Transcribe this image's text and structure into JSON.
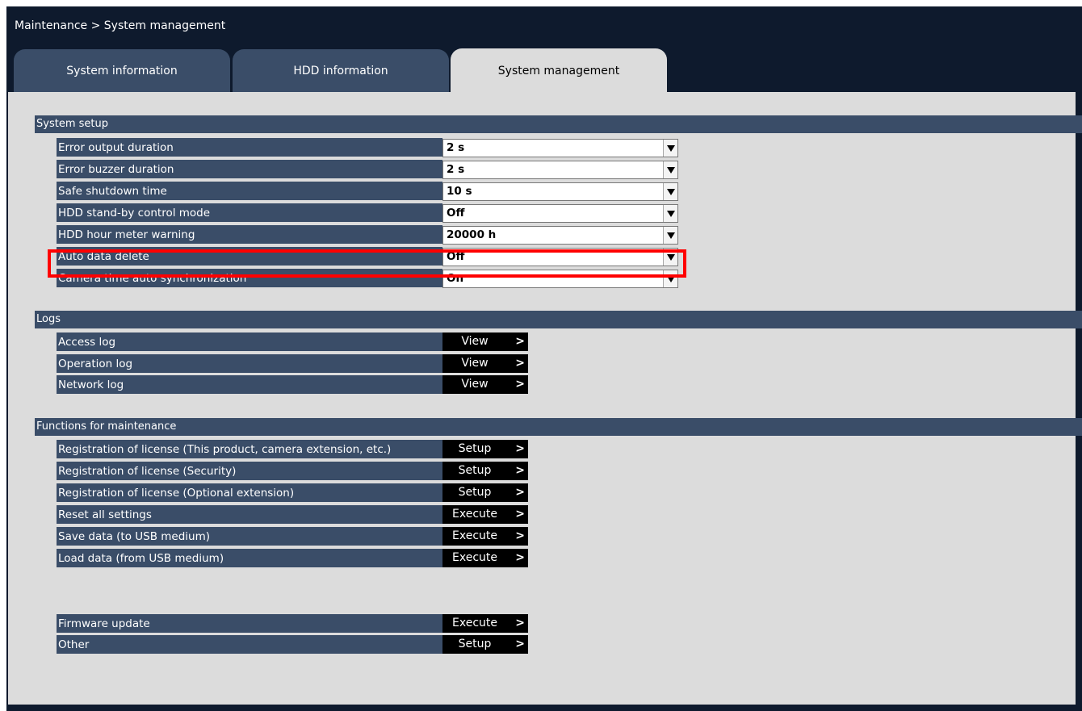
{
  "breadcrumb": "Maintenance > System management",
  "tabs": [
    {
      "label": "System information"
    },
    {
      "label": "HDD information"
    },
    {
      "label": "System management"
    }
  ],
  "sections": {
    "system_setup": "System setup",
    "logs": "Logs",
    "maintenance": "Functions for maintenance"
  },
  "system_setup": [
    {
      "label": "Error output duration",
      "value": "2 s"
    },
    {
      "label": "Error buzzer duration",
      "value": "2 s"
    },
    {
      "label": "Safe shutdown time",
      "value": "10 s"
    },
    {
      "label": "HDD stand-by control mode",
      "value": "Off"
    },
    {
      "label": "HDD hour meter warning",
      "value": "20000 h"
    },
    {
      "label": "Auto data delete",
      "value": "Off"
    },
    {
      "label": "Camera time auto synchronization",
      "value": "On"
    }
  ],
  "logs": [
    {
      "label": "Access log",
      "button": "View"
    },
    {
      "label": "Operation log",
      "button": "View"
    },
    {
      "label": "Network log",
      "button": "View"
    }
  ],
  "maintenance": [
    {
      "label": "Registration of license (This product, camera extension, etc.)",
      "button": "Setup"
    },
    {
      "label": "Registration of license (Security)",
      "button": "Setup"
    },
    {
      "label": "Registration of license (Optional extension)",
      "button": "Setup"
    },
    {
      "label": "Reset all settings",
      "button": "Execute"
    },
    {
      "label": "Save data (to USB medium)",
      "button": "Execute"
    },
    {
      "label": "Load data (from USB medium)",
      "button": "Execute"
    }
  ],
  "other": [
    {
      "label": "Firmware update",
      "button": "Execute"
    },
    {
      "label": "Other",
      "button": "Setup"
    }
  ],
  "arrow_glyph": ">",
  "colors": {
    "header_bg": "#0e1a2d",
    "tab_inactive": "#3a4d68",
    "panel_bg": "#dcdcdc",
    "label_bg": "#3a4d68",
    "button_bg": "#000000",
    "highlight": "#ff0000"
  }
}
